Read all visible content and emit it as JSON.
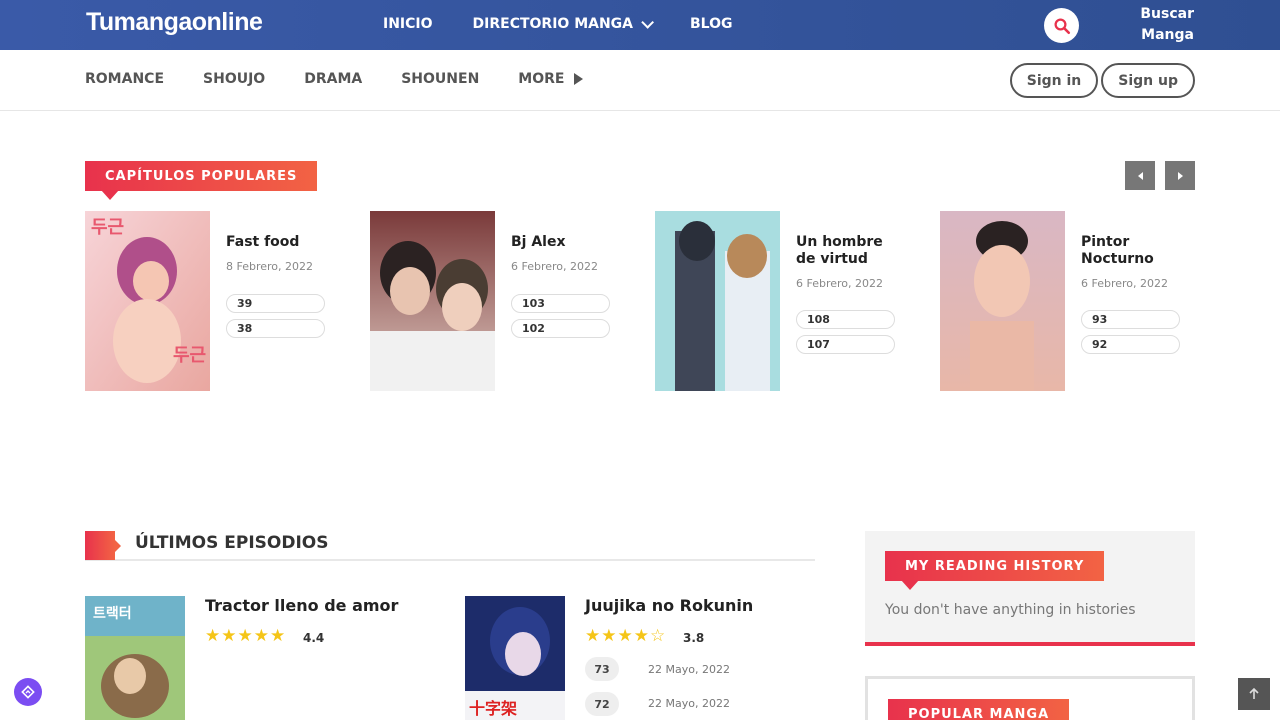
{
  "brand": {
    "logo": "Tumangaonline"
  },
  "topnav": {
    "items": [
      {
        "label": "INICIO"
      },
      {
        "label": "DIRECTORIO MANGA"
      },
      {
        "label": "BLOG"
      }
    ],
    "search_label": "Buscar Manga"
  },
  "categories": {
    "items": [
      "ROMANCE",
      "SHOUJO",
      "DRAMA",
      "SHOUNEN",
      "MORE"
    ]
  },
  "auth": {
    "signin": "Sign in",
    "signup": "Sign up"
  },
  "popular_chapters": {
    "heading": "CAPÍTULOS POPULARES",
    "cards": [
      {
        "title": "Fast food",
        "date": "8 Febrero, 2022",
        "chapters": [
          "39",
          "38"
        ]
      },
      {
        "title": "Bj Alex",
        "date": "6 Febrero, 2022",
        "chapters": [
          "103",
          "102"
        ]
      },
      {
        "title": "Un hombre de virtud",
        "date": "6 Febrero, 2022",
        "chapters": [
          "108",
          "107"
        ]
      },
      {
        "title": "Pintor Nocturno",
        "date": "6 Febrero, 2022",
        "chapters": [
          "93",
          "92"
        ]
      }
    ]
  },
  "latest": {
    "heading": "ÚLTIMOS EPISODIOS",
    "items": [
      {
        "title": "Tractor lleno de amor",
        "rating": "4.4",
        "stars": "★★★★★",
        "episodes": []
      },
      {
        "title": "Juujika no Rokunin",
        "rating": "3.8",
        "stars": "★★★★☆",
        "episodes": [
          {
            "num": "73",
            "date": "22 Mayo, 2022"
          },
          {
            "num": "72",
            "date": "22 Mayo, 2022"
          }
        ]
      }
    ]
  },
  "sidebar": {
    "history_heading": "MY READING HISTORY",
    "history_empty": "You don't have anything in histories",
    "popular_heading": "POPULAR MANGA"
  },
  "colors": {
    "brand_blue": "#3a5aa8",
    "accent_red": "#e8324c",
    "accent_orange": "#f26344",
    "star": "#f5c518"
  }
}
